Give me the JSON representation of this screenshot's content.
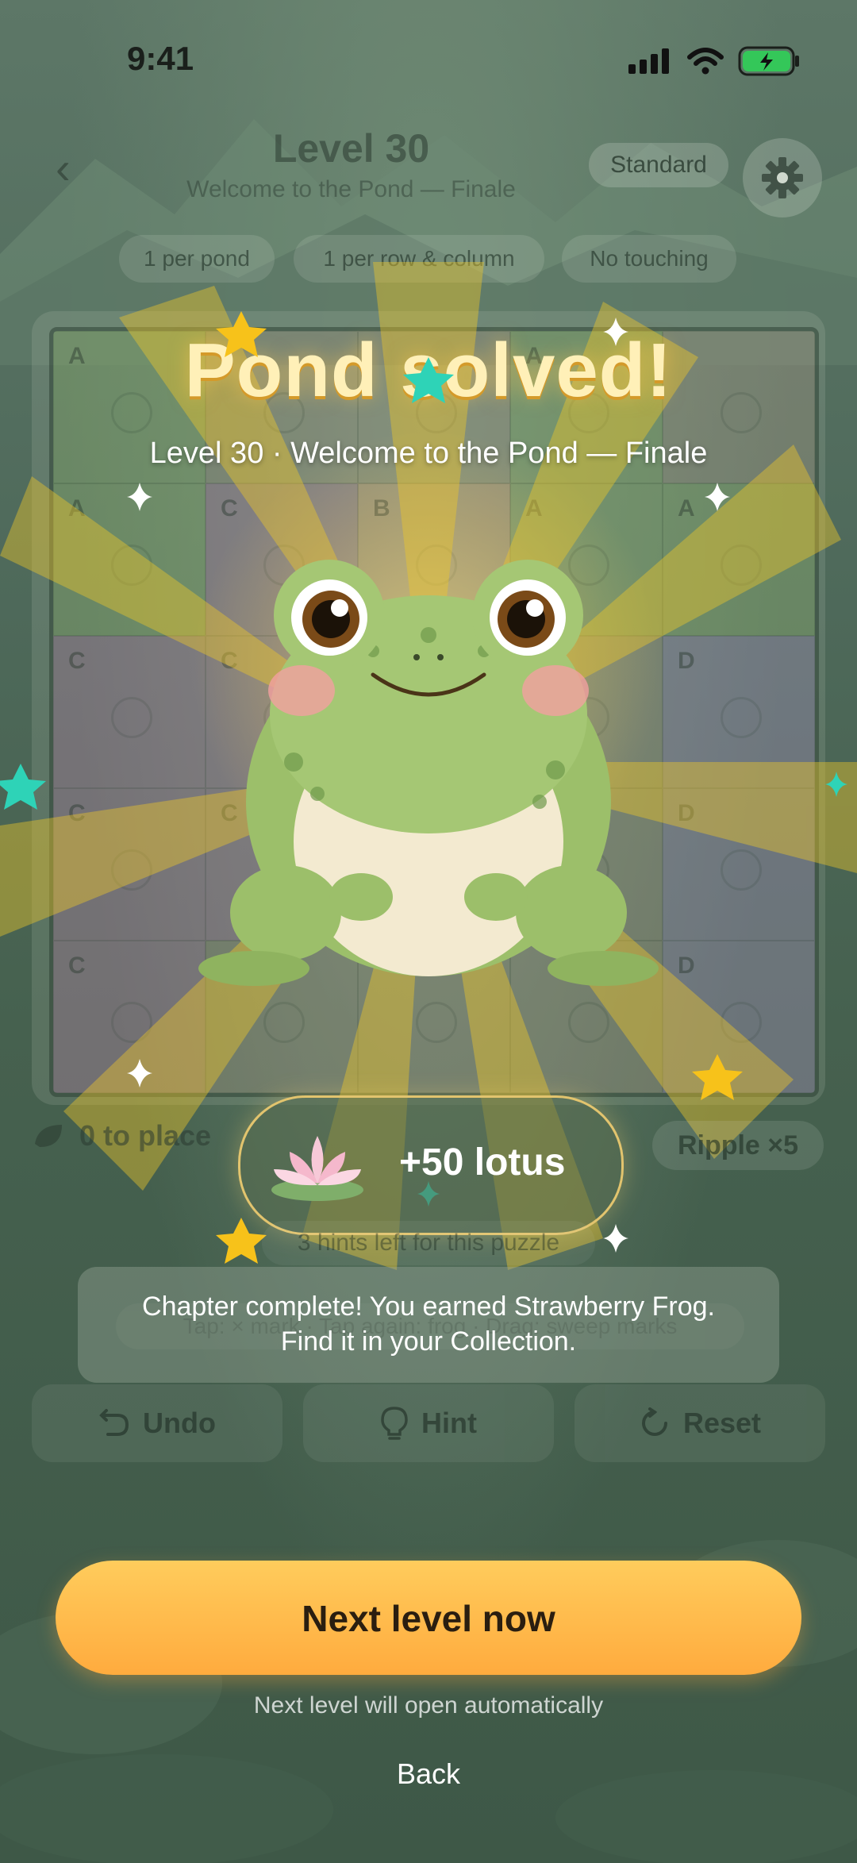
{
  "status_bar": {
    "time": "9:41"
  },
  "header": {
    "level_title": "Level 30",
    "level_subtitle": "Welcome to the Pond — Finale",
    "mode": "Standard"
  },
  "rules": [
    "1 per pond",
    "1 per row & column",
    "No touching"
  ],
  "board": {
    "rows": [
      [
        "A",
        "",
        "",
        "A",
        ""
      ],
      [
        "A",
        "C",
        "B",
        "A",
        "A"
      ],
      [
        "C",
        "C",
        "",
        "",
        "D"
      ],
      [
        "C",
        "C",
        "",
        "",
        "D"
      ],
      [
        "C",
        "",
        "",
        "",
        "D"
      ]
    ]
  },
  "overlay": {
    "title": "Pond solved!",
    "subtitle": "Level 30 · Welcome to the Pond — Finale",
    "reward_label": "+50 lotus",
    "chapter_message_line1": "Chapter complete! You earned Strawberry Frog.",
    "chapter_message_line2": "Find it in your Collection.",
    "next_button": "Next level now",
    "auto_note": "Next level will open automatically",
    "back_label": "Back"
  },
  "footer": {
    "place_count": "0 to place",
    "ripple": "Ripple ×5",
    "hints_note": "3 hints left for this puzzle",
    "helper": "Tap: × mark · Tap again: frog · Drag: sweep marks",
    "undo": "Undo",
    "hint": "Hint",
    "reset": "Reset"
  },
  "colors": {
    "accent": "#ffb547",
    "title_gold": "#fff0b8",
    "teal_star": "#2ed3b7",
    "gold_star": "#f7c21a"
  },
  "icons": [
    "back-chevron-icon",
    "gear-icon",
    "signal-icon",
    "wifi-icon",
    "battery-icon",
    "leaf-icon",
    "undo-icon",
    "bulb-icon",
    "reset-icon",
    "lotus-icon",
    "frog-illustration",
    "star-icon",
    "sparkle-icon"
  ]
}
